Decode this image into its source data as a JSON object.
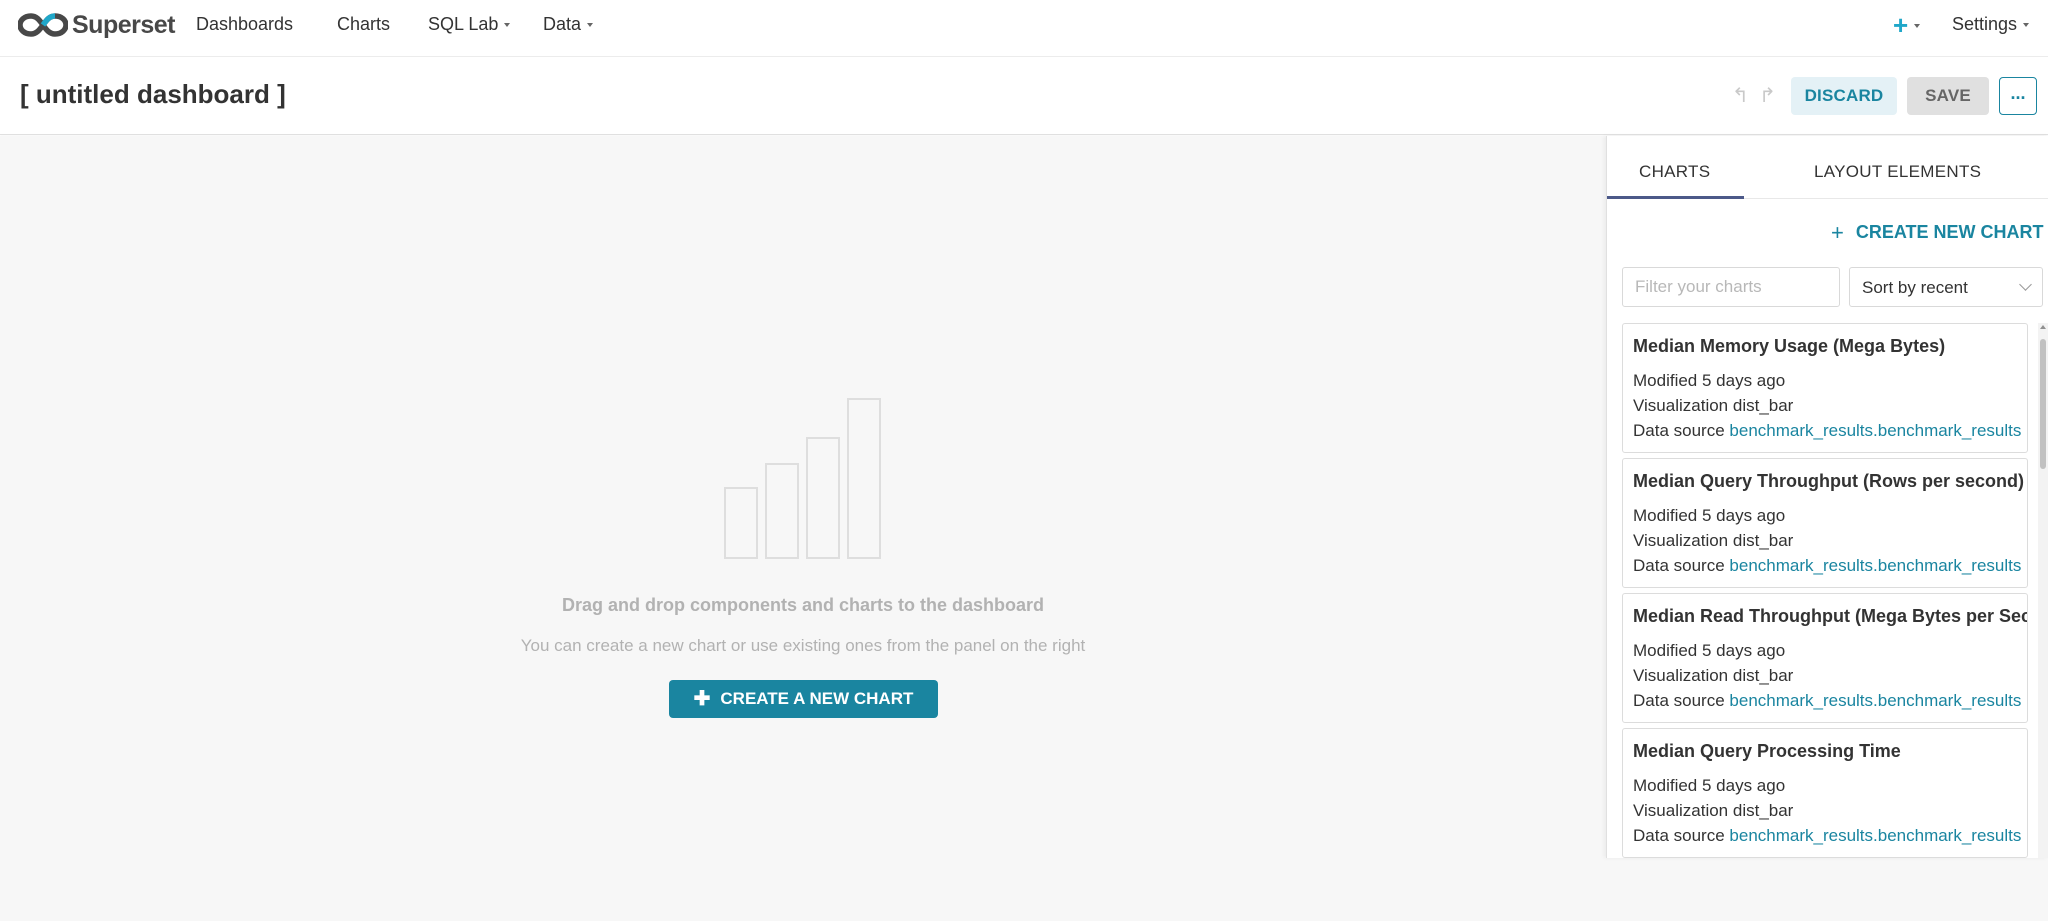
{
  "nav": {
    "brand": "Superset",
    "items": [
      {
        "label": "Dashboards",
        "has_caret": false
      },
      {
        "label": "Charts",
        "has_caret": false
      },
      {
        "label": "SQL Lab",
        "has_caret": true
      },
      {
        "label": "Data",
        "has_caret": true
      }
    ],
    "plus_label": "+",
    "settings_label": "Settings"
  },
  "header": {
    "title": "[ untitled dashboard ]",
    "undo_icon": "↰",
    "redo_icon": "↱",
    "discard_label": "DISCARD",
    "save_label": "SAVE",
    "more_label": "..."
  },
  "canvas": {
    "empty_title": "Drag and drop components and charts to the dashboard",
    "empty_subtitle": "You can create a new chart or use existing ones from the panel on the right",
    "create_button_label": "CREATE A NEW CHART"
  },
  "panel": {
    "tabs": [
      "CHARTS",
      "LAYOUT ELEMENTS"
    ],
    "active_tab": "CHARTS",
    "create_link_label": "CREATE NEW CHART",
    "filter": {
      "placeholder": "Filter your charts",
      "value": ""
    },
    "sort": {
      "selected": "Sort by recent"
    },
    "charts": [
      {
        "title": "Median Memory Usage (Mega Bytes)",
        "modified": "Modified 5 days ago",
        "visualization": "Visualization dist_bar",
        "datasource_label": "Data source",
        "datasource": "benchmark_results.benchmark_results"
      },
      {
        "title": "Median Query Throughput (Rows per second)",
        "modified": "Modified 5 days ago",
        "visualization": "Visualization dist_bar",
        "datasource_label": "Data source",
        "datasource": "benchmark_results.benchmark_results"
      },
      {
        "title": "Median Read Throughput (Mega Bytes per Second)",
        "modified": "Modified 5 days ago",
        "visualization": "Visualization dist_bar",
        "datasource_label": "Data source",
        "datasource": "benchmark_results.benchmark_results"
      },
      {
        "title": "Median Query Processing Time",
        "modified": "Modified 5 days ago",
        "visualization": "Visualization dist_bar",
        "datasource_label": "Data source",
        "datasource": "benchmark_results.benchmark_results"
      }
    ]
  },
  "colors": {
    "accent": "#1a85a0",
    "brand_plus": "#20a7c9",
    "tab_underline": "#4c5989",
    "canvas_bg": "#f7f7f7"
  },
  "icons": {
    "logo": "superset-logo-icon",
    "plus": "plus-icon",
    "undo": "undo-icon",
    "redo": "redo-icon",
    "more": "ellipsis-icon",
    "empty_state": "bar-chart-icon",
    "sort": "chevron-down-icon"
  }
}
